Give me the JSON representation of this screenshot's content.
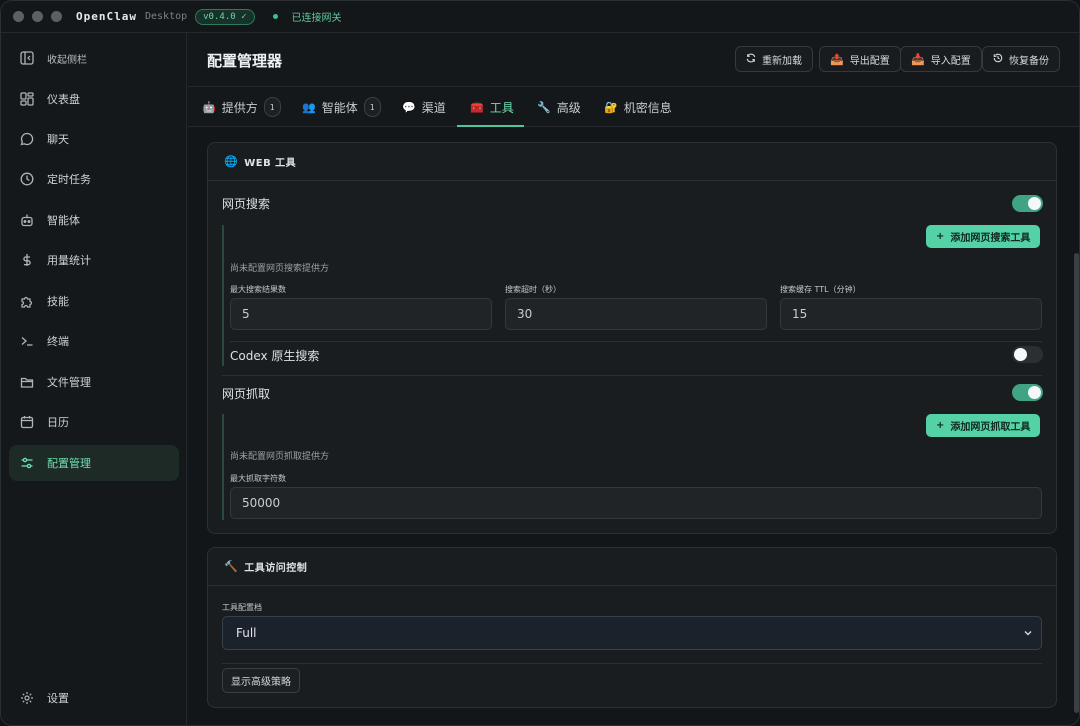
{
  "titlebar": {
    "app_name": "OpenClaw",
    "app_sub": "Desktop",
    "version": "v0.4.0 ✓",
    "gateway_status": "已连接网关"
  },
  "sidebar": {
    "collapse_label": "收起侧栏",
    "items": [
      {
        "label": "仪表盘",
        "icon": "dashboard-icon"
      },
      {
        "label": "聊天",
        "icon": "chat-icon"
      },
      {
        "label": "定时任务",
        "icon": "clock-icon"
      },
      {
        "label": "智能体",
        "icon": "robot-icon"
      },
      {
        "label": "用量统计",
        "icon": "dollar-icon"
      },
      {
        "label": "技能",
        "icon": "puzzle-icon"
      },
      {
        "label": "终端",
        "icon": "terminal-icon"
      },
      {
        "label": "文件管理",
        "icon": "folder-icon"
      },
      {
        "label": "日历",
        "icon": "calendar-icon"
      },
      {
        "label": "配置管理",
        "icon": "sliders-icon"
      }
    ],
    "settings_label": "设置"
  },
  "header": {
    "title": "配置管理器",
    "buttons": {
      "reload": "重新加载",
      "export": "导出配置",
      "import": "导入配置",
      "restore": "恢复备份"
    }
  },
  "tabs": [
    {
      "label": "提供方",
      "emoji": "🤖",
      "count": "1"
    },
    {
      "label": "智能体",
      "emoji": "👥",
      "count": "1"
    },
    {
      "label": "渠道",
      "emoji": "💬"
    },
    {
      "label": "工具",
      "emoji": "🧰"
    },
    {
      "label": "高级",
      "emoji": "🔧"
    },
    {
      "label": "机密信息",
      "emoji": "🔐"
    }
  ],
  "web_tools": {
    "title": "WEB 工具",
    "title_emoji": "🌐",
    "web_search": {
      "label": "网页搜索",
      "enabled": true,
      "add_button": "添加网页搜索工具",
      "empty_hint": "尚未配置网页搜索提供方",
      "fields": [
        {
          "label": "最大搜索结果数",
          "value": "5"
        },
        {
          "label": "搜索超时（秒）",
          "value": "30"
        },
        {
          "label": "搜索缓存 TTL（分钟）",
          "value": "15"
        }
      ],
      "codex_label": "Codex 原生搜索",
      "codex_enabled": false
    },
    "web_fetch": {
      "label": "网页抓取",
      "enabled": true,
      "add_button": "添加网页抓取工具",
      "empty_hint": "尚未配置网页抓取提供方",
      "max_chars_label": "最大抓取字符数",
      "max_chars_value": "50000"
    }
  },
  "access_control": {
    "title": "工具访问控制",
    "title_emoji": "🔨",
    "profile_label": "工具配置档",
    "profile_value": "Full",
    "advanced_button": "显示高级策略"
  },
  "colors": {
    "accent": "#55d1a6",
    "background": "#15181b",
    "card": "#1a1d20"
  }
}
